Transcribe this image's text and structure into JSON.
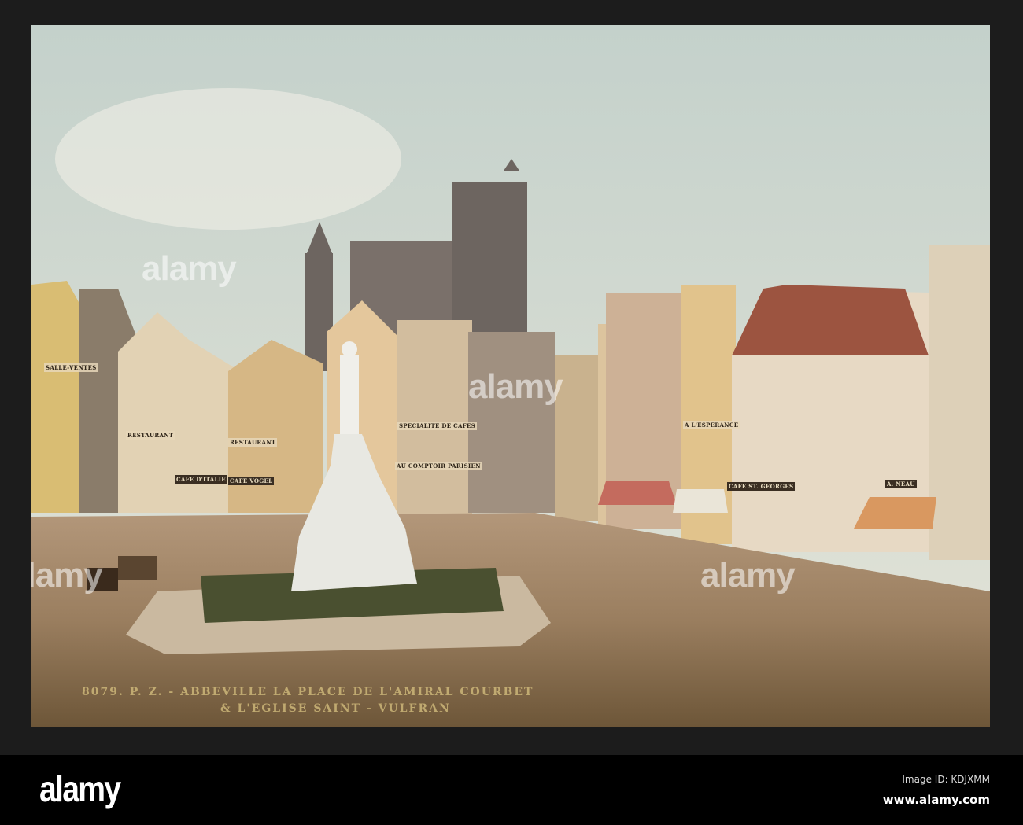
{
  "photo": {
    "caption_line1": "8079. P. Z. - ABBEVILLE LA PLACE DE L'AMIRAL COURBET",
    "caption_line2": "& L'EGLISE SAINT - VULFRAN",
    "signs": [
      "SALLE-VENTES",
      "RESTAURANT",
      "RESTAURANT",
      "CAFE D'ITALIE",
      "CAFE VOGEL",
      "SPECIALITE DE CAFES",
      "AU COMPTOIR PARISIEN",
      "A L'ESPERANCE",
      "CAFE ST. GEORGES",
      "A. NEAU"
    ],
    "watermark": "alamy"
  },
  "footer": {
    "logo": "alamy",
    "image_id": "Image ID: KDJXMM",
    "website": "www.alamy.com"
  }
}
